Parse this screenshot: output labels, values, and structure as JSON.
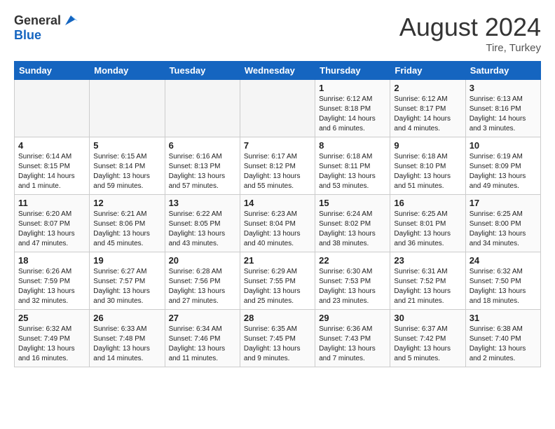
{
  "header": {
    "logo_general": "General",
    "logo_blue": "Blue",
    "month_title": "August 2024",
    "location": "Tire, Turkey"
  },
  "days_of_week": [
    "Sunday",
    "Monday",
    "Tuesday",
    "Wednesday",
    "Thursday",
    "Friday",
    "Saturday"
  ],
  "weeks": [
    [
      {
        "num": "",
        "info": "",
        "empty": true
      },
      {
        "num": "",
        "info": "",
        "empty": true
      },
      {
        "num": "",
        "info": "",
        "empty": true
      },
      {
        "num": "",
        "info": "",
        "empty": true
      },
      {
        "num": "1",
        "info": "Sunrise: 6:12 AM\nSunset: 8:18 PM\nDaylight: 14 hours\nand 6 minutes."
      },
      {
        "num": "2",
        "info": "Sunrise: 6:12 AM\nSunset: 8:17 PM\nDaylight: 14 hours\nand 4 minutes."
      },
      {
        "num": "3",
        "info": "Sunrise: 6:13 AM\nSunset: 8:16 PM\nDaylight: 14 hours\nand 3 minutes."
      }
    ],
    [
      {
        "num": "4",
        "info": "Sunrise: 6:14 AM\nSunset: 8:15 PM\nDaylight: 14 hours\nand 1 minute."
      },
      {
        "num": "5",
        "info": "Sunrise: 6:15 AM\nSunset: 8:14 PM\nDaylight: 13 hours\nand 59 minutes."
      },
      {
        "num": "6",
        "info": "Sunrise: 6:16 AM\nSunset: 8:13 PM\nDaylight: 13 hours\nand 57 minutes."
      },
      {
        "num": "7",
        "info": "Sunrise: 6:17 AM\nSunset: 8:12 PM\nDaylight: 13 hours\nand 55 minutes."
      },
      {
        "num": "8",
        "info": "Sunrise: 6:18 AM\nSunset: 8:11 PM\nDaylight: 13 hours\nand 53 minutes."
      },
      {
        "num": "9",
        "info": "Sunrise: 6:18 AM\nSunset: 8:10 PM\nDaylight: 13 hours\nand 51 minutes."
      },
      {
        "num": "10",
        "info": "Sunrise: 6:19 AM\nSunset: 8:09 PM\nDaylight: 13 hours\nand 49 minutes."
      }
    ],
    [
      {
        "num": "11",
        "info": "Sunrise: 6:20 AM\nSunset: 8:07 PM\nDaylight: 13 hours\nand 47 minutes."
      },
      {
        "num": "12",
        "info": "Sunrise: 6:21 AM\nSunset: 8:06 PM\nDaylight: 13 hours\nand 45 minutes."
      },
      {
        "num": "13",
        "info": "Sunrise: 6:22 AM\nSunset: 8:05 PM\nDaylight: 13 hours\nand 43 minutes."
      },
      {
        "num": "14",
        "info": "Sunrise: 6:23 AM\nSunset: 8:04 PM\nDaylight: 13 hours\nand 40 minutes."
      },
      {
        "num": "15",
        "info": "Sunrise: 6:24 AM\nSunset: 8:02 PM\nDaylight: 13 hours\nand 38 minutes."
      },
      {
        "num": "16",
        "info": "Sunrise: 6:25 AM\nSunset: 8:01 PM\nDaylight: 13 hours\nand 36 minutes."
      },
      {
        "num": "17",
        "info": "Sunrise: 6:25 AM\nSunset: 8:00 PM\nDaylight: 13 hours\nand 34 minutes."
      }
    ],
    [
      {
        "num": "18",
        "info": "Sunrise: 6:26 AM\nSunset: 7:59 PM\nDaylight: 13 hours\nand 32 minutes."
      },
      {
        "num": "19",
        "info": "Sunrise: 6:27 AM\nSunset: 7:57 PM\nDaylight: 13 hours\nand 30 minutes."
      },
      {
        "num": "20",
        "info": "Sunrise: 6:28 AM\nSunset: 7:56 PM\nDaylight: 13 hours\nand 27 minutes."
      },
      {
        "num": "21",
        "info": "Sunrise: 6:29 AM\nSunset: 7:55 PM\nDaylight: 13 hours\nand 25 minutes."
      },
      {
        "num": "22",
        "info": "Sunrise: 6:30 AM\nSunset: 7:53 PM\nDaylight: 13 hours\nand 23 minutes."
      },
      {
        "num": "23",
        "info": "Sunrise: 6:31 AM\nSunset: 7:52 PM\nDaylight: 13 hours\nand 21 minutes."
      },
      {
        "num": "24",
        "info": "Sunrise: 6:32 AM\nSunset: 7:50 PM\nDaylight: 13 hours\nand 18 minutes."
      }
    ],
    [
      {
        "num": "25",
        "info": "Sunrise: 6:32 AM\nSunset: 7:49 PM\nDaylight: 13 hours\nand 16 minutes."
      },
      {
        "num": "26",
        "info": "Sunrise: 6:33 AM\nSunset: 7:48 PM\nDaylight: 13 hours\nand 14 minutes."
      },
      {
        "num": "27",
        "info": "Sunrise: 6:34 AM\nSunset: 7:46 PM\nDaylight: 13 hours\nand 11 minutes."
      },
      {
        "num": "28",
        "info": "Sunrise: 6:35 AM\nSunset: 7:45 PM\nDaylight: 13 hours\nand 9 minutes."
      },
      {
        "num": "29",
        "info": "Sunrise: 6:36 AM\nSunset: 7:43 PM\nDaylight: 13 hours\nand 7 minutes."
      },
      {
        "num": "30",
        "info": "Sunrise: 6:37 AM\nSunset: 7:42 PM\nDaylight: 13 hours\nand 5 minutes."
      },
      {
        "num": "31",
        "info": "Sunrise: 6:38 AM\nSunset: 7:40 PM\nDaylight: 13 hours\nand 2 minutes."
      }
    ]
  ]
}
